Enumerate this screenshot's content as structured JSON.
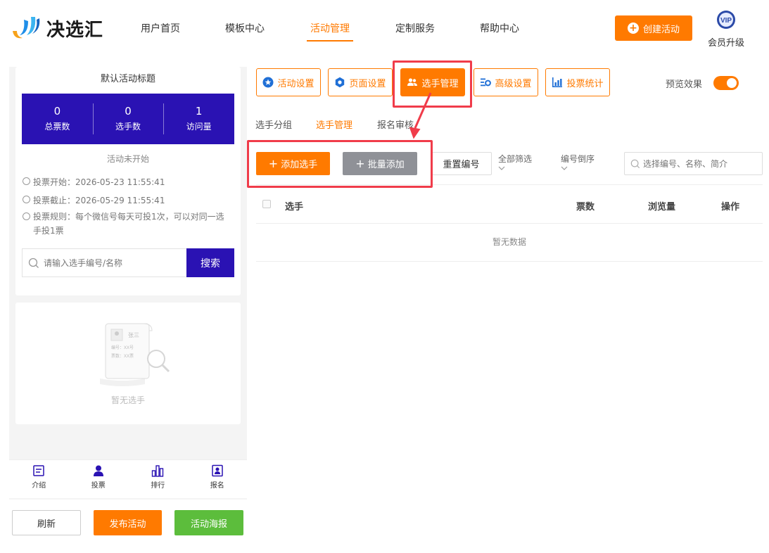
{
  "header": {
    "logo_text": "决选汇",
    "nav": [
      "用户首页",
      "模板中心",
      "活动管理",
      "定制服务",
      "帮助中心"
    ],
    "nav_active": "活动管理",
    "create_label": "创建活动",
    "vip_badge": "VIP",
    "vip_label": "会员升级"
  },
  "left": {
    "title": "默认活动标题",
    "stats": [
      {
        "value": "0",
        "label": "总票数"
      },
      {
        "value": "0",
        "label": "选手数"
      },
      {
        "value": "1",
        "label": "访问量"
      }
    ],
    "status": "活动未开始",
    "vote_start": "投票开始：2026-05-23 11:55:41",
    "vote_end": "投票截止：2026-05-29 11:55:41",
    "vote_rule": "投票规则：每个微信号每天可投1次，可以对同一选手投1票",
    "search_placeholder": "请输入选手编号/名称",
    "search_button": "搜索",
    "empty_card": {
      "name": "张三",
      "number": "编号：XX号",
      "votes": "票数：XX票",
      "empty_text": "暂无选手"
    },
    "tabs": [
      "介绍",
      "投票",
      "排行",
      "报名"
    ],
    "active_tab": "投票"
  },
  "footer": {
    "refresh": "刷新",
    "publish": "发布活动",
    "poster": "活动海报"
  },
  "toolbar": {
    "activity_settings": "活动设置",
    "page_settings": "页面设置",
    "player_management": "选手管理",
    "advanced_settings": "高级设置",
    "vote_stats": "投票统计",
    "preview_label": "预览效果",
    "preview_on": true
  },
  "subtabs": [
    "选手分组",
    "选手管理",
    "报名审核"
  ],
  "subtab_active": "选手管理",
  "actions": {
    "add_player": "添加选手",
    "batch_add": "批量添加",
    "reset_number": "重置编号",
    "filter_all": "全部筛选",
    "sort_desc": "编号倒序",
    "search_placeholder": "选择编号、名称、简介"
  },
  "table": {
    "columns": [
      "选手",
      "票数",
      "浏览量",
      "操作"
    ],
    "empty": "暂无数据"
  },
  "colors": {
    "accent": "#ff7a00",
    "brand": "#2a12b3",
    "green": "#5cbd3c",
    "gray_button": "#8f9197",
    "highlight": "#f03c4a"
  }
}
